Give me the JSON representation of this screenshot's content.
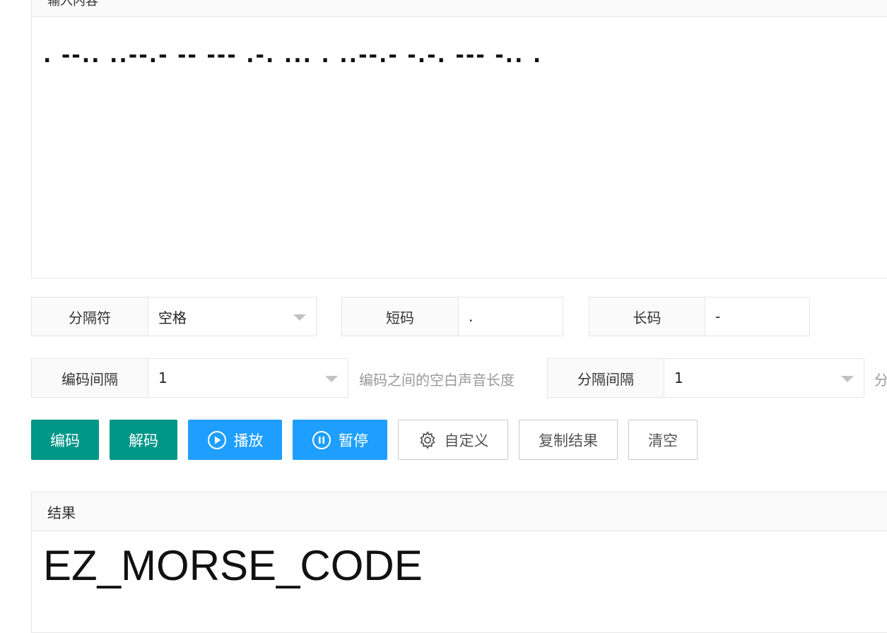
{
  "input": {
    "header": "输入内容",
    "value": ". --.. ..--.- -- --- .-. ... . ..--.- -.-. --- -.. ."
  },
  "options": {
    "separator": {
      "label": "分隔符",
      "value": "空格"
    },
    "short_code": {
      "label": "短码",
      "value": "."
    },
    "long_code": {
      "label": "长码",
      "value": "-"
    },
    "code_interval": {
      "label": "编码间隔",
      "value": "1",
      "hint": "编码之间的空白声音长度"
    },
    "separator_interval": {
      "label": "分隔间隔",
      "value": "1",
      "hint": "分"
    }
  },
  "buttons": {
    "encode": "编码",
    "decode": "解码",
    "play": "播放",
    "pause": "暂停",
    "custom": "自定义",
    "copy": "复制结果",
    "clear": "清空"
  },
  "result": {
    "header": "结果",
    "value": "EZ_MORSE_CODE"
  },
  "colors": {
    "green": "#009688",
    "blue": "#1e9fff"
  },
  "icons": [
    "play-circle-icon",
    "pause-circle-icon",
    "gear-icon",
    "chevron-down-icon"
  ]
}
